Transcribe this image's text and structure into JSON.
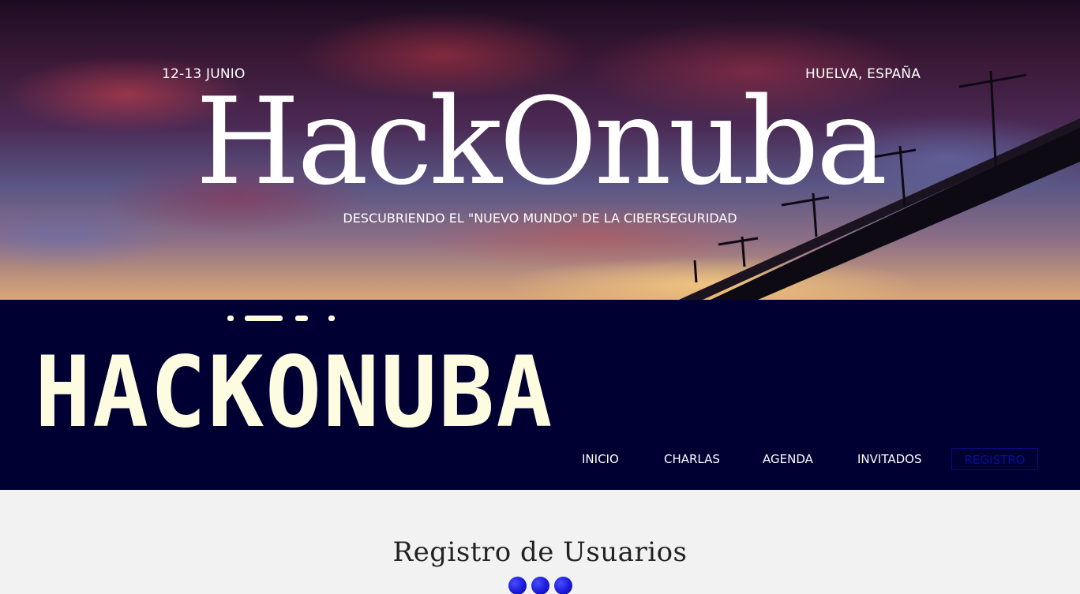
{
  "hero": {
    "date": "12-13 JUNIO",
    "location": "HUELVA, ESPAÑA",
    "title": "HackOnuba",
    "subtitle": "DESCUBRIENDO EL \"NUEVO MUNDO\" DE LA CIBERSEGURIDAD"
  },
  "header": {
    "logo_text": "HACKONUBA"
  },
  "nav": {
    "items": [
      "INICIO",
      "CHARLAS",
      "AGENDA",
      "INVITADOS",
      "REGISTRO"
    ]
  },
  "content": {
    "title": "Registro de Usuarios"
  },
  "colors": {
    "navy": "#000033",
    "logo": "#fdfbe0",
    "accent": "#1a1ad8",
    "background": "#f2f2f2"
  }
}
